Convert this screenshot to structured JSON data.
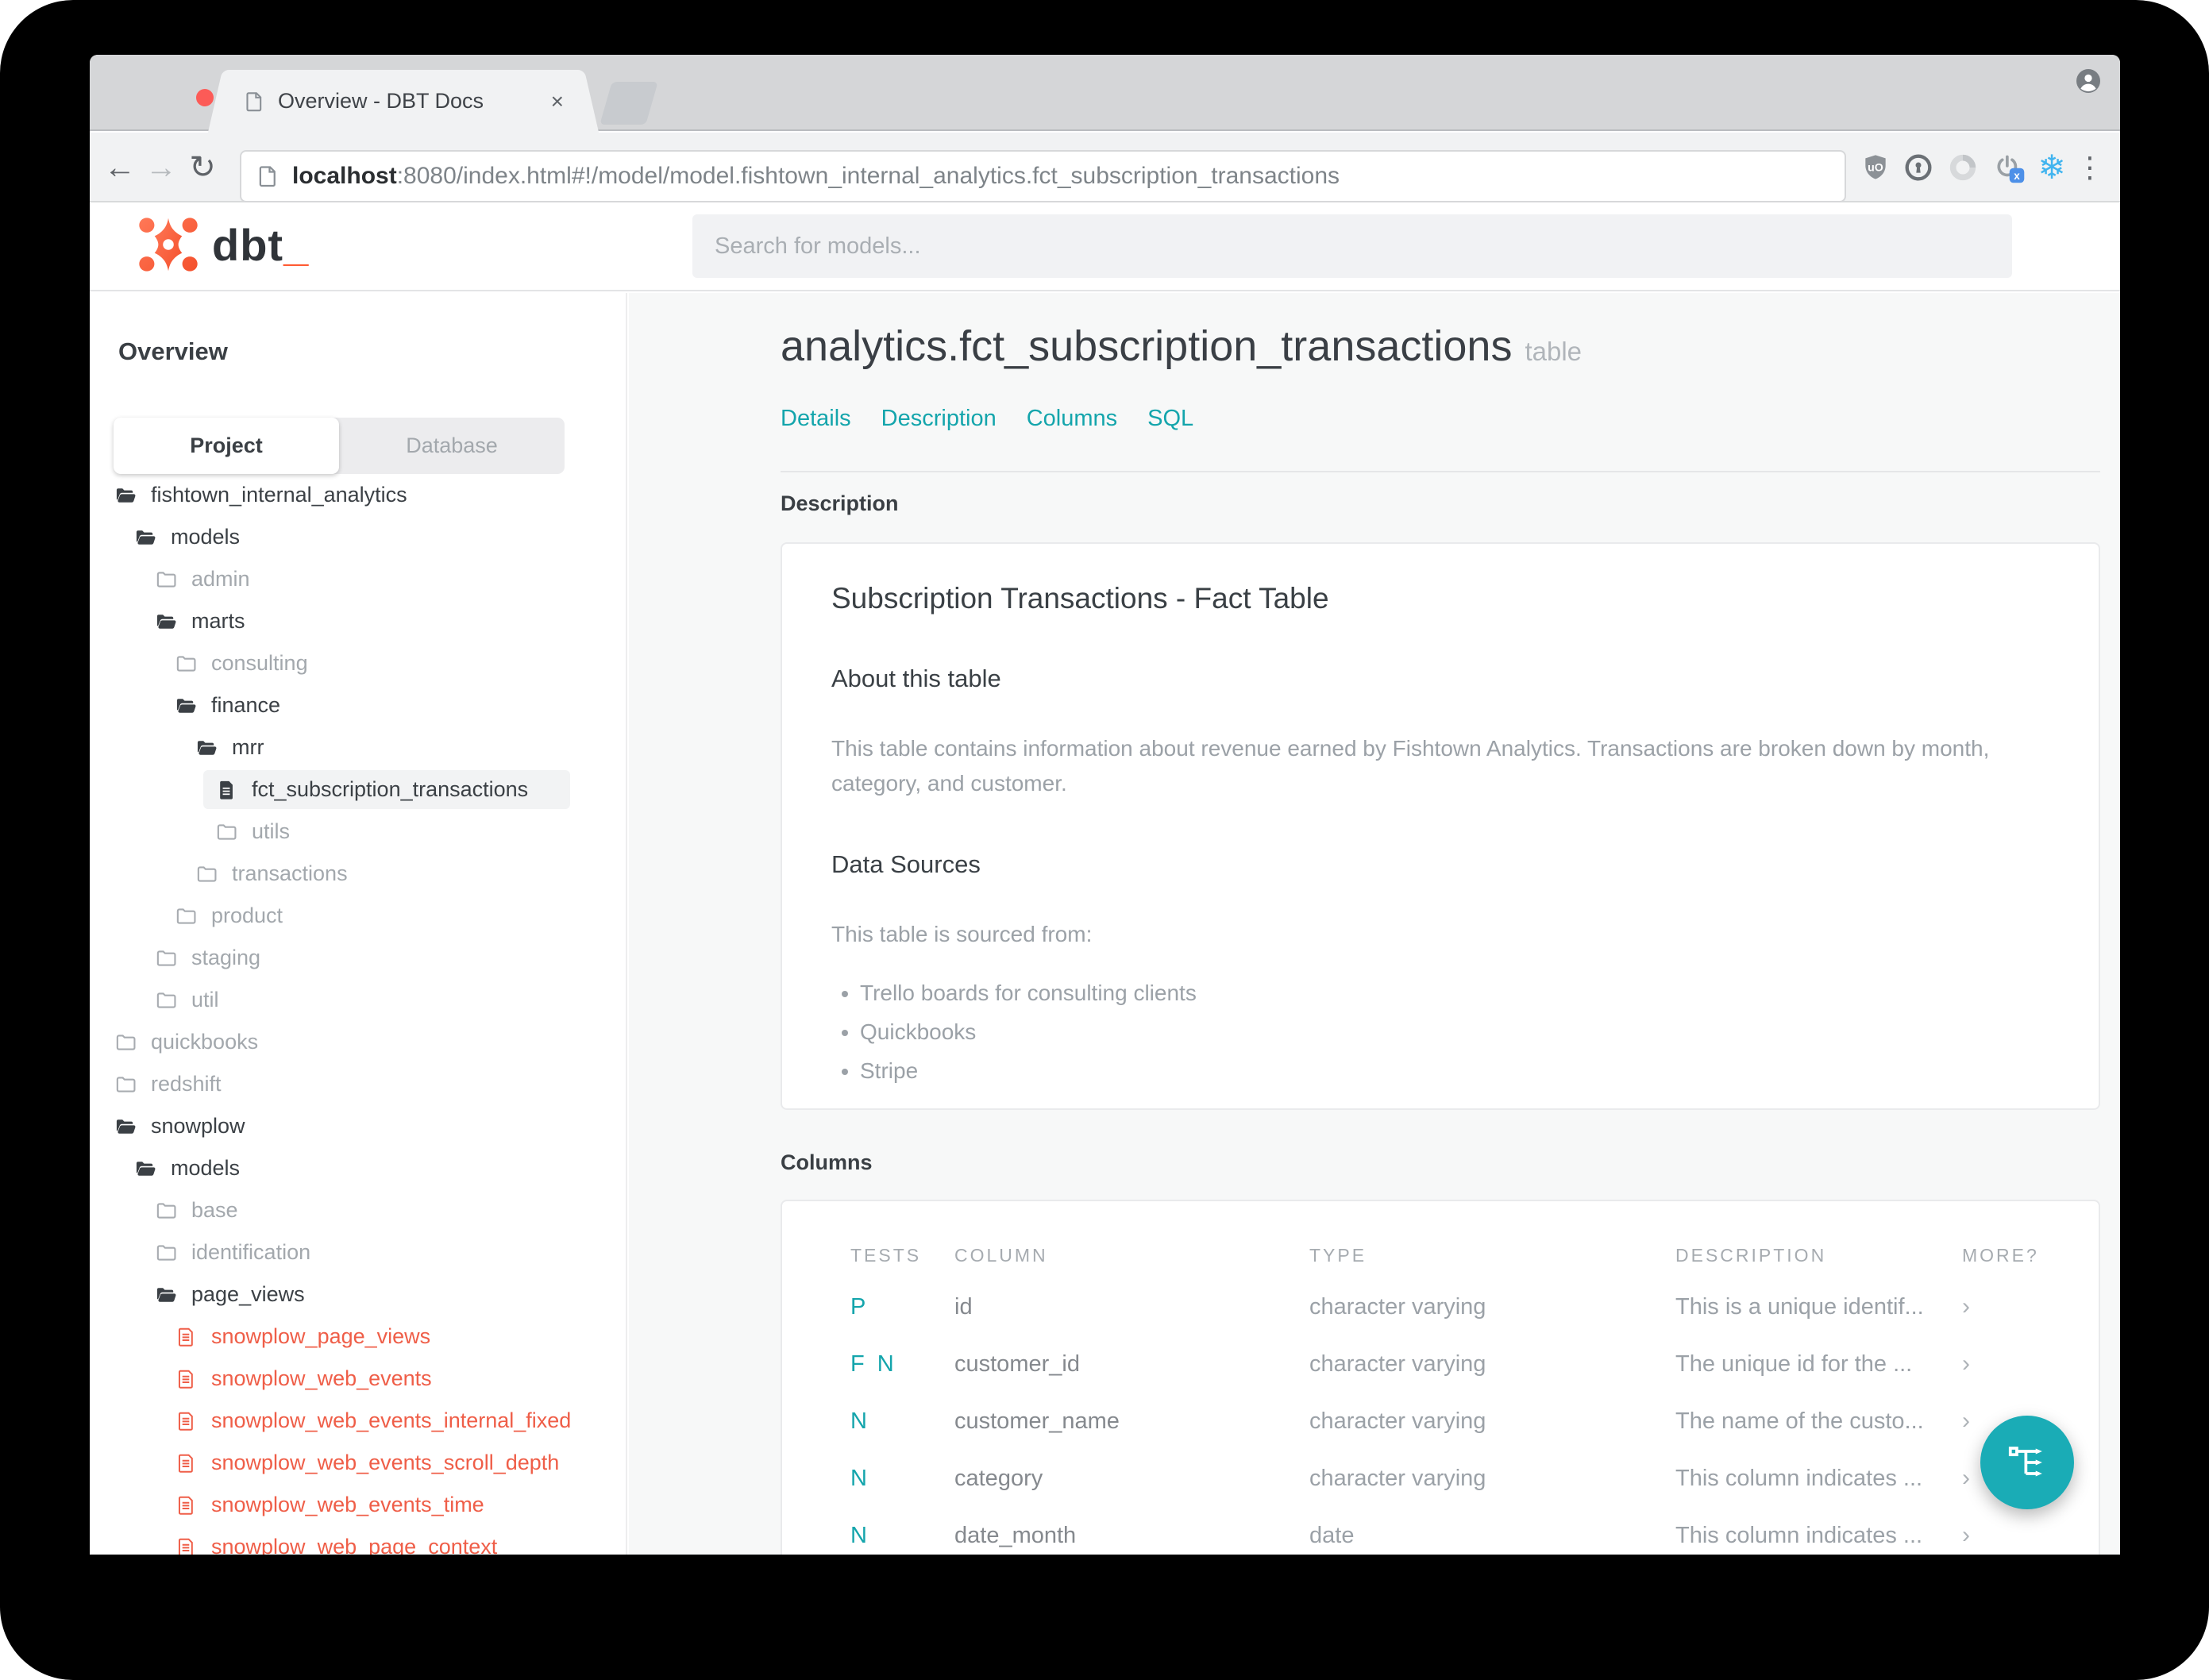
{
  "colors": {
    "accent_teal": "#14a5ac",
    "fab_teal": "#1aacb6",
    "model_red": "#ef5e48",
    "logo_orange": "#ff5c35"
  },
  "browser": {
    "tab": {
      "title": "Overview - DBT Docs",
      "close_glyph": "×"
    },
    "url": {
      "host": "localhost",
      "rest": ":8080/index.html#!/model/model.fishtown_internal_analytics.fct_subscription_transactions"
    },
    "nav_glyphs": {
      "back": "←",
      "forward": "→",
      "reload": "↻"
    },
    "extension_icons": [
      "ublock-origin-icon",
      "onepassword-icon",
      "disabled-extension-icon",
      "proxy-x-icon",
      "snowflake-icon"
    ],
    "menu_glyph": "⋮",
    "snowflake_glyph": "❄"
  },
  "header": {
    "logo_text": "dbt",
    "logo_cursor": "_",
    "search_placeholder": "Search for models..."
  },
  "sidebar": {
    "heading": "Overview",
    "tabs": [
      {
        "label": "Project",
        "active": true
      },
      {
        "label": "Database",
        "active": false
      }
    ],
    "tree": [
      {
        "label": "fishtown_internal_analytics",
        "depth": 0,
        "icon": "folder-open",
        "variant": "dark"
      },
      {
        "label": "models",
        "depth": 1,
        "icon": "folder-open",
        "variant": "dark"
      },
      {
        "label": "admin",
        "depth": 2,
        "icon": "folder-closed",
        "variant": "muted"
      },
      {
        "label": "marts",
        "depth": 2,
        "icon": "folder-open",
        "variant": "dark"
      },
      {
        "label": "consulting",
        "depth": 3,
        "icon": "folder-closed",
        "variant": "muted"
      },
      {
        "label": "finance",
        "depth": 3,
        "icon": "folder-open",
        "variant": "dark"
      },
      {
        "label": "mrr",
        "depth": 4,
        "icon": "folder-open",
        "variant": "dark"
      },
      {
        "label": "fct_subscription_transactions",
        "depth": 5,
        "icon": "file",
        "variant": "dark",
        "selected": true
      },
      {
        "label": "utils",
        "depth": 5,
        "icon": "folder-closed",
        "variant": "muted"
      },
      {
        "label": "transactions",
        "depth": 4,
        "icon": "folder-closed",
        "variant": "muted"
      },
      {
        "label": "product",
        "depth": 3,
        "icon": "folder-closed",
        "variant": "muted"
      },
      {
        "label": "staging",
        "depth": 2,
        "icon": "folder-closed",
        "variant": "muted"
      },
      {
        "label": "util",
        "depth": 2,
        "icon": "folder-closed",
        "variant": "muted"
      },
      {
        "label": "quickbooks",
        "depth": 0,
        "icon": "folder-closed",
        "variant": "muted"
      },
      {
        "label": "redshift",
        "depth": 0,
        "icon": "folder-closed",
        "variant": "muted"
      },
      {
        "label": "snowplow",
        "depth": 0,
        "icon": "folder-open",
        "variant": "dark"
      },
      {
        "label": "models",
        "depth": 1,
        "icon": "folder-open",
        "variant": "dark"
      },
      {
        "label": "base",
        "depth": 2,
        "icon": "folder-closed",
        "variant": "muted"
      },
      {
        "label": "identification",
        "depth": 2,
        "icon": "folder-closed",
        "variant": "muted"
      },
      {
        "label": "page_views",
        "depth": 2,
        "icon": "folder-open",
        "variant": "dark"
      },
      {
        "label": "snowplow_page_views",
        "depth": 3,
        "icon": "file-red",
        "variant": "red"
      },
      {
        "label": "snowplow_web_events",
        "depth": 3,
        "icon": "file-red",
        "variant": "red"
      },
      {
        "label": "snowplow_web_events_internal_fixed",
        "depth": 3,
        "icon": "file-red",
        "variant": "red"
      },
      {
        "label": "snowplow_web_events_scroll_depth",
        "depth": 3,
        "icon": "file-red",
        "variant": "red"
      },
      {
        "label": "snowplow_web_events_time",
        "depth": 3,
        "icon": "file-red",
        "variant": "red"
      },
      {
        "label": "snowplow_web_page_context",
        "depth": 3,
        "icon": "file-red",
        "variant": "red"
      }
    ]
  },
  "main": {
    "title": "analytics.fct_subscription_transactions",
    "title_badge": "table",
    "nav": [
      "Details",
      "Description",
      "Columns",
      "SQL"
    ],
    "description_section": {
      "label": "Description",
      "card_title": "Subscription Transactions - Fact Table",
      "about_heading": "About this table",
      "about_text": "This table contains information about revenue earned by Fishtown Analytics. Transactions are broken down by month, category, and customer.",
      "sources_heading": "Data Sources",
      "sources_intro": "This table is sourced from:",
      "sources": [
        "Trello boards for consulting clients",
        "Quickbooks",
        "Stripe"
      ]
    },
    "columns_section": {
      "label": "Columns",
      "headers": [
        "TESTS",
        "COLUMN",
        "TYPE",
        "DESCRIPTION",
        "MORE?"
      ],
      "rows": [
        {
          "tests": "P",
          "column": "id",
          "type": "character varying",
          "description": "This is a unique identif...",
          "more": "›"
        },
        {
          "tests": "F N",
          "column": "customer_id",
          "type": "character varying",
          "description": "The unique id for the ...",
          "more": "›"
        },
        {
          "tests": "N",
          "column": "customer_name",
          "type": "character varying",
          "description": "The name of the custo...",
          "more": "›"
        },
        {
          "tests": "N",
          "column": "category",
          "type": "character varying",
          "description": "This column indicates ...",
          "more": "›"
        },
        {
          "tests": "N",
          "column": "date_month",
          "type": "date",
          "description": "This column indicates ...",
          "more": "›"
        }
      ]
    }
  },
  "fab": {
    "icon": "lineage-graph-icon"
  }
}
